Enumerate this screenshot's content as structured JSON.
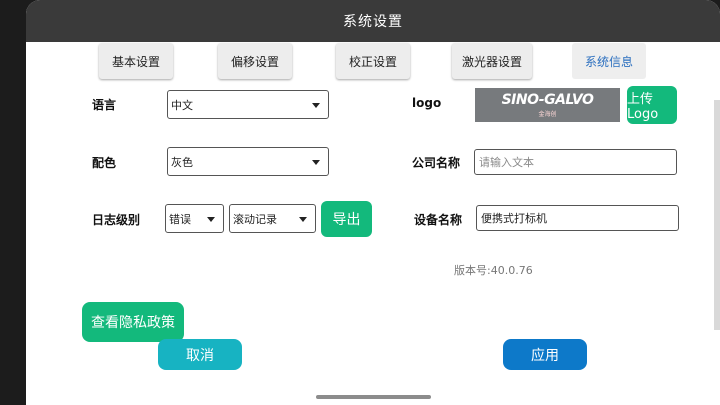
{
  "title": "系统设置",
  "tabs": [
    "基本设置",
    "偏移设置",
    "校正设置",
    "激光器设置",
    "系统信息"
  ],
  "language": {
    "label": "语言",
    "value": "中文"
  },
  "color_scheme": {
    "label": "配色",
    "value": "灰色"
  },
  "log_level": {
    "label": "日志级别",
    "level": "错误",
    "mode": "滚动记录",
    "export_label": "导出"
  },
  "logo": {
    "label": "logo",
    "brand_text": "SINO-GALVO",
    "brand_sub": "金海创",
    "upload_label": "上传Logo"
  },
  "company": {
    "label": "公司名称",
    "placeholder": "请输入文本",
    "value": ""
  },
  "device": {
    "label": "设备名称",
    "value": "便携式打标机"
  },
  "version": "版本号:40.0.76",
  "privacy_label": "查看隐私政策",
  "cancel_label": "取消",
  "apply_label": "应用",
  "colors": {
    "accent_green": "#13b97c",
    "cancel_teal": "#17b3c2",
    "apply_blue": "#0d79c9",
    "titlebar": "#3a3a3a"
  }
}
